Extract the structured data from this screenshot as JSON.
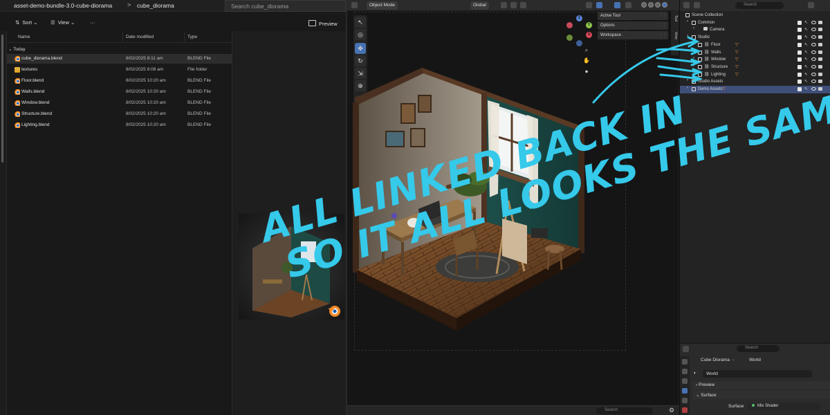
{
  "explorer": {
    "breadcrumb": [
      "asset-demo-bundle-3.0-cube-diorama",
      "cube_diorama"
    ],
    "breadcrumb_separator": ">",
    "search_placeholder": "Search cube_diorama",
    "commands": {
      "sort": "Sort",
      "view": "View",
      "more": "···"
    },
    "preview_label": "Preview",
    "columns": {
      "name": "Name",
      "date": "Date modified",
      "type": "Type"
    },
    "group": "Today",
    "files": [
      {
        "name": "cube_diorama.blend",
        "date": "8/02/2025 8:11 am",
        "type": "BLEND File",
        "icon": "blender-file-icon",
        "selected": true
      },
      {
        "name": "textures",
        "date": "8/02/2025 8:08 am",
        "type": "File folder",
        "icon": "folder-icon",
        "selected": false
      },
      {
        "name": "Floor.blend",
        "date": "8/02/2025 10:20 am",
        "type": "BLEND File",
        "icon": "blender-file-icon",
        "selected": false
      },
      {
        "name": "Walls.blend",
        "date": "8/02/2025 10:20 am",
        "type": "BLEND File",
        "icon": "blender-file-icon",
        "selected": false
      },
      {
        "name": "Window.blend",
        "date": "8/02/2025 10:20 am",
        "type": "BLEND File",
        "icon": "blender-file-icon",
        "selected": false
      },
      {
        "name": "Structure.blend",
        "date": "8/02/2025 10:20 am",
        "type": "BLEND File",
        "icon": "blender-file-icon",
        "selected": false
      },
      {
        "name": "Lighting.blend",
        "date": "8/02/2025 10:20 am",
        "type": "BLEND File",
        "icon": "blender-file-icon",
        "selected": false
      }
    ]
  },
  "viewport": {
    "mode": "Object Mode",
    "transform": "Global",
    "panels": [
      "Active Tool",
      "Options",
      "Workspace"
    ],
    "side_tabs": [
      "Tool",
      "View"
    ],
    "axes": {
      "x": "X",
      "y": "Y",
      "z": "Z"
    },
    "search_placeholder": "Search",
    "accent_color": "#4772b3"
  },
  "outliner": {
    "search_placeholder": "Search",
    "rows": [
      {
        "label": "Scene Collection",
        "depth": 0,
        "kind": "scene",
        "highlight": false
      },
      {
        "label": "Common",
        "depth": 1,
        "kind": "collection",
        "highlight": false
      },
      {
        "label": "Camera",
        "depth": 2,
        "kind": "camera",
        "highlight": false
      },
      {
        "label": "Studio",
        "depth": 1,
        "kind": "collection",
        "highlight": false
      },
      {
        "label": "Floor",
        "depth": 2,
        "kind": "linked",
        "highlight": false
      },
      {
        "label": "Walls",
        "depth": 2,
        "kind": "linked",
        "highlight": false
      },
      {
        "label": "Window",
        "depth": 2,
        "kind": "linked",
        "highlight": false
      },
      {
        "label": "Structure",
        "depth": 2,
        "kind": "linked",
        "highlight": false
      },
      {
        "label": "Lighting",
        "depth": 2,
        "kind": "linked",
        "highlight": false
      },
      {
        "label": "Studio Assets",
        "depth": 1,
        "kind": "collection",
        "highlight": false
      },
      {
        "label": "Demo Assets",
        "depth": 1,
        "kind": "collection",
        "highlight": true
      }
    ]
  },
  "properties": {
    "search_placeholder": "Search",
    "breadcrumb_scene": "Cube Diorama",
    "breadcrumb_world": "World",
    "world_name": "World",
    "sections": [
      "Preview",
      "Surface"
    ],
    "surface_label": "Surface",
    "surface_value": "Mix Shader"
  },
  "annotation": {
    "line1": "ALL LINKED BACK IN",
    "line2": "SO IT ALL LOOKS THE SAME!",
    "color": "#35c9ea"
  }
}
